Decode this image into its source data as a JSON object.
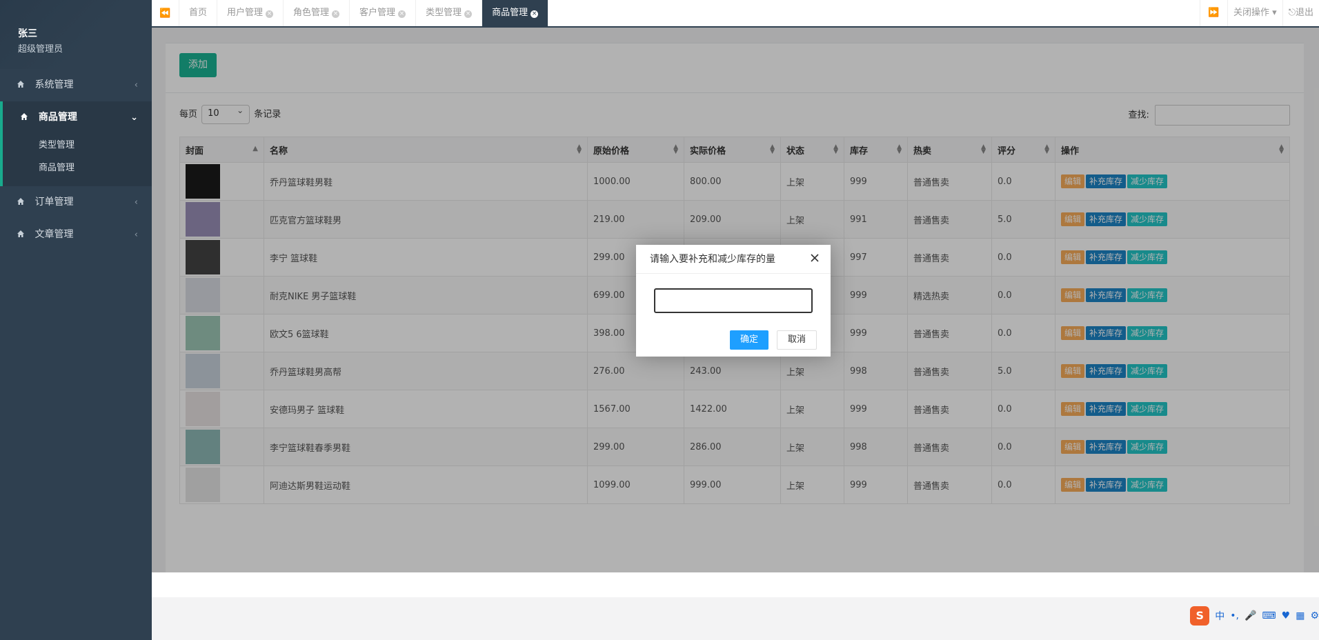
{
  "profile": {
    "name": "张三",
    "role": "超级管理员"
  },
  "sidebar": {
    "menus": [
      {
        "label": "系统管理",
        "arrow": "‹"
      },
      {
        "label": "商品管理",
        "arrow": "⌄",
        "children": [
          "类型管理",
          "商品管理"
        ]
      },
      {
        "label": "订单管理",
        "arrow": "‹"
      },
      {
        "label": "文章管理",
        "arrow": "‹"
      }
    ]
  },
  "tabs": {
    "items": [
      "首页",
      "用户管理",
      "角色管理",
      "客户管理",
      "类型管理",
      "商品管理"
    ],
    "active_index": 5,
    "close_all": "关闭操作",
    "logout": "退出"
  },
  "toolbar": {
    "add_label": "添加"
  },
  "table_controls": {
    "per_page_prefix": "每页",
    "per_page_value": "10",
    "per_page_suffix": "条记录",
    "search_label": "查找:"
  },
  "table": {
    "headers": [
      "封面",
      "名称",
      "原始价格",
      "实际价格",
      "状态",
      "库存",
      "热卖",
      "评分",
      "操作"
    ],
    "rows": [
      {
        "name": "乔丹篮球鞋男鞋",
        "orig": "1000.00",
        "actual": "800.00",
        "status": "上架",
        "stock": "999",
        "hot": "普通售卖",
        "score": "0.0",
        "thumb": "#1b1b1b"
      },
      {
        "name": "匹克官方篮球鞋男",
        "orig": "219.00",
        "actual": "209.00",
        "status": "上架",
        "stock": "991",
        "hot": "普通售卖",
        "score": "5.0",
        "thumb": "#9a90b8"
      },
      {
        "name": "李宁 篮球鞋",
        "orig": "299.00",
        "actual": "",
        "status": "",
        "stock": "997",
        "hot": "普通售卖",
        "score": "0.0",
        "thumb": "#444"
      },
      {
        "name": "耐克NIKE 男子篮球鞋",
        "orig": "699.00",
        "actual": "",
        "status": "",
        "stock": "999",
        "hot": "精选热卖",
        "score": "0.0",
        "thumb": "#d9dce2"
      },
      {
        "name": "欧文5 6篮球鞋",
        "orig": "398.00",
        "actual": "378.00",
        "status": "上架",
        "stock": "999",
        "hot": "普通售卖",
        "score": "0.0",
        "thumb": "#9ec7b6"
      },
      {
        "name": "乔丹篮球鞋男高帮",
        "orig": "276.00",
        "actual": "243.00",
        "status": "上架",
        "stock": "998",
        "hot": "普通售卖",
        "score": "5.0",
        "thumb": "#c9d3dd"
      },
      {
        "name": "安德玛男子 篮球鞋",
        "orig": "1567.00",
        "actual": "1422.00",
        "status": "上架",
        "stock": "999",
        "hot": "普通售卖",
        "score": "0.0",
        "thumb": "#e8e2e2"
      },
      {
        "name": "李宁篮球鞋春季男鞋",
        "orig": "299.00",
        "actual": "286.00",
        "status": "上架",
        "stock": "998",
        "hot": "普通售卖",
        "score": "0.0",
        "thumb": "#8fb9b7"
      },
      {
        "name": "阿迪达斯男鞋运动鞋",
        "orig": "1099.00",
        "actual": "999.00",
        "status": "上架",
        "stock": "999",
        "hot": "普通售卖",
        "score": "0.0",
        "thumb": "#e6e6e6"
      }
    ],
    "actions": {
      "edit": "编辑",
      "add_stock": "补充库存",
      "reduce_stock": "减少库存"
    }
  },
  "dialog": {
    "title": "请输入要补充和减少库存的量",
    "input_value": "",
    "ok_label": "确定",
    "cancel_label": "取消"
  },
  "ime": {
    "mode": "中",
    "logo": "S"
  },
  "colors": {
    "sidebar": "#2f4050",
    "accent": "#1ab394",
    "edit": "#f8ac59",
    "add_stock": "#1c84c6",
    "reduce_stock": "#23c6c8",
    "dialog_ok": "#1e9fff"
  }
}
